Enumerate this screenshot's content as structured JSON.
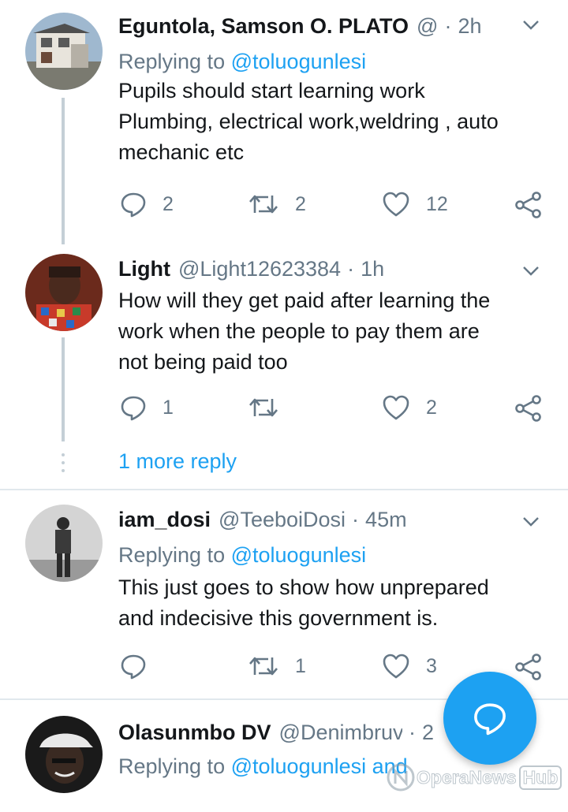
{
  "tweets": [
    {
      "name": "Eguntola, Samson O. PLATO",
      "handle": "@",
      "time": "2h",
      "replying_prefix": "Replying to",
      "replying_to": "@toluogunlesi",
      "text": "Pupils should start learning work\nPlumbing, electrical work,weldring , auto\nmechanic etc",
      "replies": "2",
      "retweets": "2",
      "likes": "12",
      "avatar_icon": "house-photo"
    },
    {
      "name": "Light",
      "handle": "@Light12623384",
      "time": "1h",
      "text": "How will they get paid after learning the\nwork when the people to pay them are\nnot being paid too",
      "replies": "1",
      "retweets": "",
      "likes": "2",
      "avatar_icon": "person-photo"
    },
    {
      "name": "iam_dosi",
      "handle": "@TeeboiDosi",
      "time": "45m",
      "replying_prefix": "Replying to",
      "replying_to": "@toluogunlesi",
      "text": "This just goes to show how unprepared\nand indecisive this government is.",
      "replies": "",
      "retweets": "1",
      "likes": "3",
      "avatar_icon": "person-standing-photo"
    },
    {
      "name": "Olasunmbo DV",
      "handle": "@Denimbruv",
      "time": "2",
      "replying_prefix": "Replying to",
      "replying_to": "@toluogunlesi and",
      "avatar_icon": "person-cap-photo"
    }
  ],
  "more_reply": "1 more reply",
  "separator": "·",
  "watermark": {
    "brand": "OperaNews",
    "suffix": "Hub"
  },
  "colors": {
    "accent": "#1da1f2",
    "secondary_text": "#657786",
    "thread_line": "#c4cfd6"
  },
  "icons": [
    "reply-icon",
    "retweet-icon",
    "like-icon",
    "share-icon",
    "chevron-down-icon",
    "compose-reply-icon"
  ]
}
